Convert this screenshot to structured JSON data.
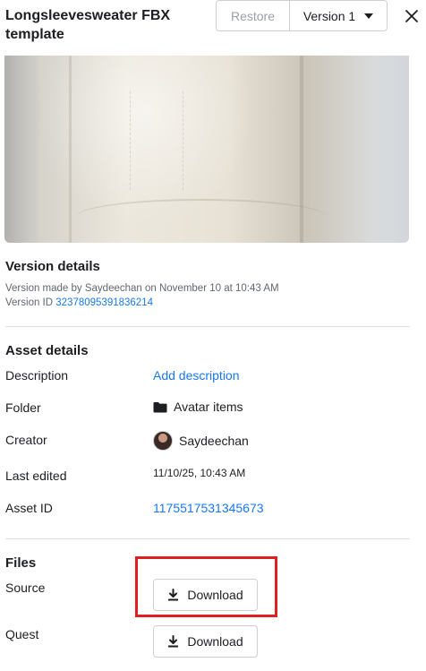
{
  "header": {
    "title": "Longsleevesweater FBX template",
    "restore_label": "Restore",
    "version_label": "Version 1"
  },
  "version_details": {
    "heading": "Version details",
    "made_by_text": "Version made by Saydeechan on November 10 at 10:43 AM",
    "version_id_label": "Version ID",
    "version_id_value": "32378095391836214"
  },
  "asset_details": {
    "heading": "Asset details",
    "rows": [
      {
        "label": "Description",
        "value": "Add description"
      },
      {
        "label": "Folder",
        "value": "Avatar items"
      },
      {
        "label": "Creator",
        "value": "Saydeechan"
      },
      {
        "label": "Last edited",
        "value": "11/10/25, 10:43 AM"
      },
      {
        "label": "Asset ID",
        "value": "1175517531345673"
      }
    ]
  },
  "files": {
    "heading": "Files",
    "rows": [
      {
        "label": "Source",
        "button": "Download"
      },
      {
        "label": "Quest",
        "button": "Download"
      }
    ]
  },
  "colors": {
    "link": "#1877f2",
    "highlight": "#e02020"
  }
}
